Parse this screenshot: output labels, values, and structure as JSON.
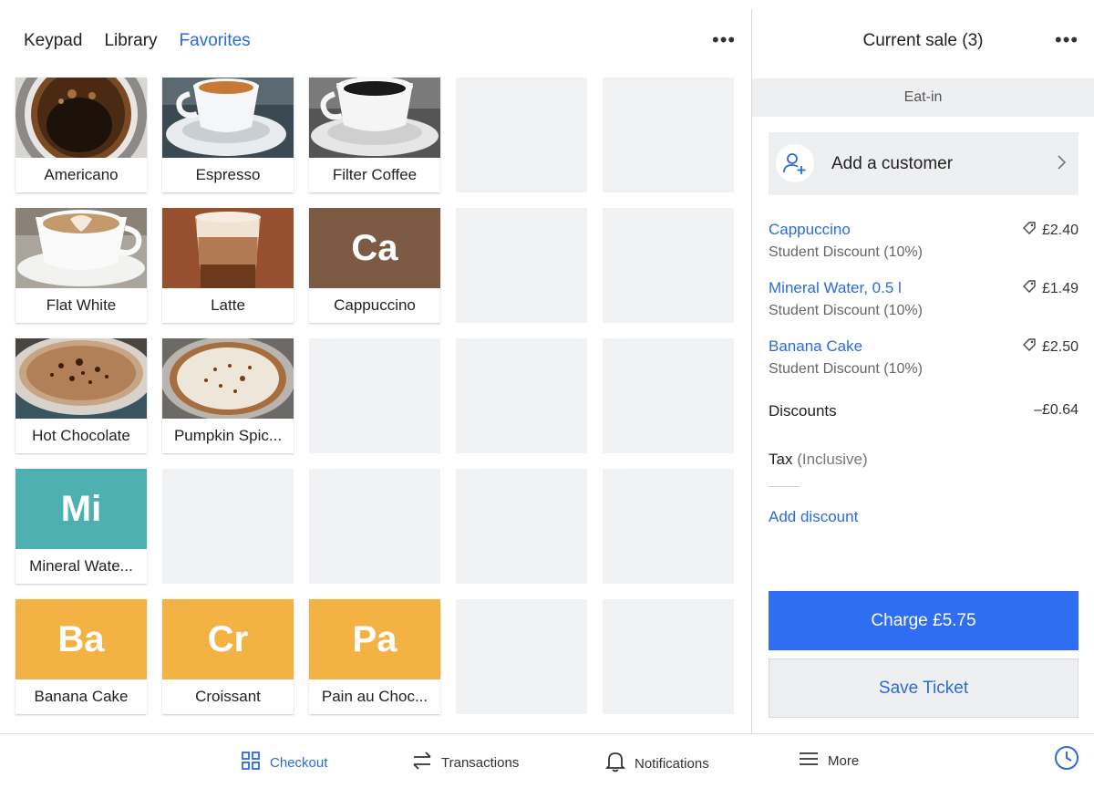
{
  "tabs": [
    {
      "label": "Keypad",
      "active": false
    },
    {
      "label": "Library",
      "active": false
    },
    {
      "label": "Favorites",
      "active": true
    }
  ],
  "grid": {
    "tiles": [
      {
        "name": "Americano",
        "image": "americano-photo"
      },
      {
        "name": "Espresso",
        "image": "espresso-photo"
      },
      {
        "name": "Filter Coffee",
        "image": "filter-coffee-photo"
      },
      {
        "name": "Flat White",
        "image": "flat-white-photo"
      },
      {
        "name": "Latte",
        "image": "latte-photo"
      },
      {
        "name": "Cappuccino",
        "abbr": "Ca",
        "color": "#7d5a43"
      },
      {
        "name": "Hot Chocolate",
        "image": "hot-chocolate-photo"
      },
      {
        "name": "Pumpkin Spic...",
        "image": "pumpkin-spice-photo"
      },
      {
        "name": "Mineral Wate...",
        "abbr": "Mi",
        "color": "#4fb0b2"
      },
      {
        "name": "Banana Cake",
        "abbr": "Ba",
        "color": "#f3b244"
      },
      {
        "name": "Croissant",
        "abbr": "Cr",
        "color": "#f3b244"
      },
      {
        "name": "Pain au Choc...",
        "abbr": "Pa",
        "color": "#f3b244"
      }
    ]
  },
  "sale": {
    "title": "Current sale (3)",
    "dining_option": "Eat-in",
    "customer_label": "Add a customer",
    "items": [
      {
        "name": "Cappuccino",
        "discount": "Student Discount (10%)",
        "price": "£2.40"
      },
      {
        "name": "Mineral Water, 0.5 l",
        "discount": "Student Discount (10%)",
        "price": "£1.49"
      },
      {
        "name": "Banana Cake",
        "discount": "Student Discount (10%)",
        "price": "£2.50"
      }
    ],
    "discounts_label": "Discounts",
    "discounts_value": "–£0.64",
    "tax_label": "Tax",
    "tax_note": "(Inclusive)",
    "add_discount": "Add discount",
    "charge_label": "Charge £5.75",
    "save_label": "Save Ticket"
  },
  "nav": {
    "items": [
      {
        "label": "Checkout",
        "icon": "grid-icon",
        "active": true
      },
      {
        "label": "Transactions",
        "icon": "arrows-icon",
        "active": false
      },
      {
        "label": "Notifications",
        "icon": "bell-icon",
        "active": false
      },
      {
        "label": "More",
        "icon": "hamburger-icon",
        "active": false
      }
    ]
  },
  "colors": {
    "accent": "#2a6bdc",
    "charge": "#2f6ef2",
    "panel": "#eeeff1"
  }
}
